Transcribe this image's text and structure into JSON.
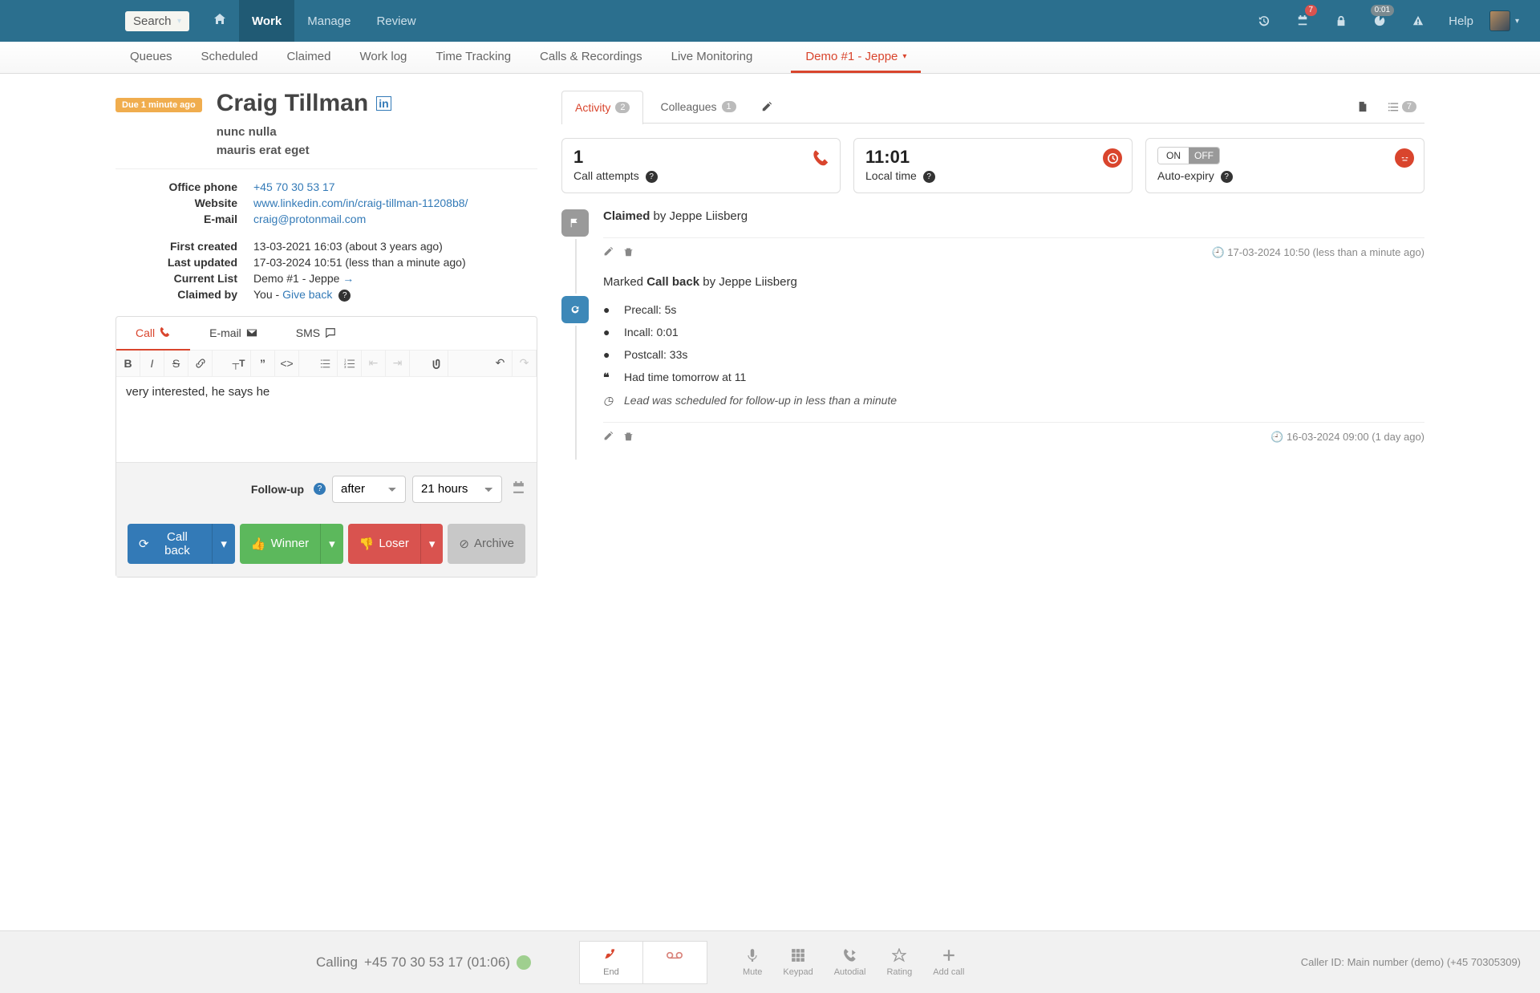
{
  "topbar": {
    "search_label": "Search",
    "nav": {
      "work": "Work",
      "manage": "Manage",
      "review": "Review"
    },
    "calendar_badge": "7",
    "timer_badge": "0:01",
    "help": "Help"
  },
  "subnav": {
    "queues": "Queues",
    "scheduled": "Scheduled",
    "claimed": "Claimed",
    "worklog": "Work log",
    "timetracking": "Time Tracking",
    "calls": "Calls & Recordings",
    "live": "Live Monitoring",
    "active": "Demo #1 - Jeppe"
  },
  "lead": {
    "due_badge": "Due 1 minute ago",
    "name": "Craig Tillman",
    "sub1": "nunc nulla",
    "sub2": "mauris erat eget",
    "details": {
      "office_phone_label": "Office phone",
      "office_phone": "+45 70 30 53 17",
      "website_label": "Website",
      "website": "www.linkedin.com/in/craig-tillman-11208b8/",
      "email_label": "E-mail",
      "email": "craig@protonmail.com",
      "first_created_label": "First created",
      "first_created": "13-03-2021 16:03 (about 3 years ago)",
      "last_updated_label": "Last updated",
      "last_updated": "17-03-2024 10:51 (less than a minute ago)",
      "current_list_label": "Current List",
      "current_list": "Demo #1 - Jeppe",
      "claimed_by_label": "Claimed by",
      "claimed_by_prefix": "You - ",
      "give_back": "Give back"
    }
  },
  "editor": {
    "tab_call": "Call",
    "tab_email": "E-mail",
    "tab_sms": "SMS",
    "content": "very interested, he says he",
    "followup_label": "Follow-up",
    "followup_mode": "after",
    "followup_value": "21 hours",
    "btn_callback": "Call back",
    "btn_winner": "Winner",
    "btn_loser": "Loser",
    "btn_archive": "Archive"
  },
  "right": {
    "tab_activity": "Activity",
    "tab_activity_count": "2",
    "tab_colleagues": "Colleagues",
    "tab_colleagues_count": "1",
    "list_count": "7",
    "card_attempts_value": "1",
    "card_attempts_label": "Call attempts",
    "card_time_value": "11:01",
    "card_time_label": "Local time",
    "card_expiry_on": "ON",
    "card_expiry_off": "OFF",
    "card_expiry_label": "Auto-expiry"
  },
  "timeline": {
    "e1": {
      "prefix": "Claimed",
      "by": " by Jeppe Liisberg",
      "ts": "17-03-2024 10:50 (less than a minute ago)"
    },
    "e2": {
      "prefix": "Marked ",
      "bold": "Call back",
      "by": " by Jeppe Liisberg",
      "precall": "Precall: 5s",
      "incall": "Incall: 0:01",
      "postcall": "Postcall: 33s",
      "quote": "Had time tomorrow at 11",
      "sched": "Lead was scheduled for follow-up in less than a minute",
      "ts": "16-03-2024 09:00 (1 day ago)"
    }
  },
  "callbar": {
    "status_prefix": "Calling ",
    "status_number": "+45 70 30 53 17 (01:06)",
    "end": "End",
    "mute": "Mute",
    "keypad": "Keypad",
    "autodial": "Autodial",
    "rating": "Rating",
    "addcall": "Add call",
    "callerid": "Caller ID: Main number (demo) (+45 70305309)"
  }
}
